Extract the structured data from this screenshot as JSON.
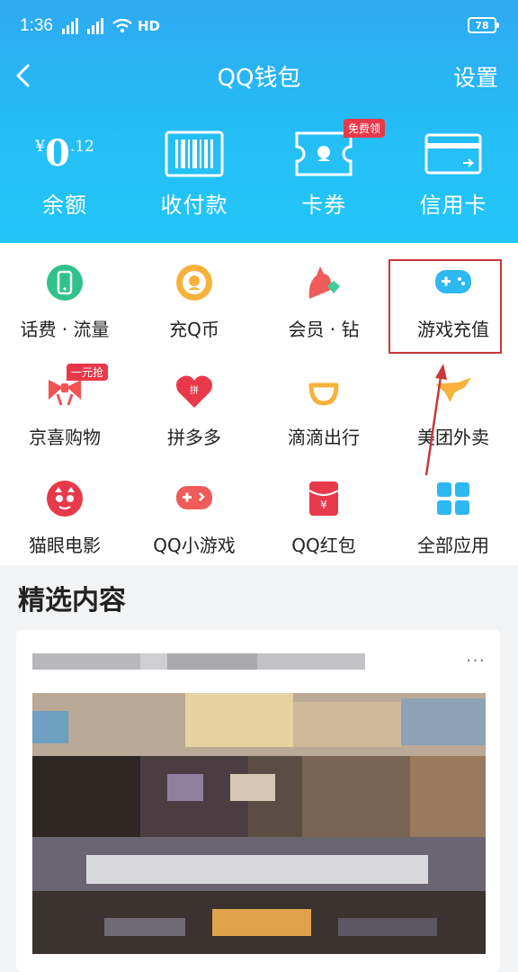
{
  "status": {
    "time": "1:36",
    "network_1": "4G",
    "network_2": "4G",
    "hd": "HD",
    "battery": "78"
  },
  "header": {
    "title": "QQ钱包",
    "settings": "设置"
  },
  "quick": {
    "balance": {
      "currency": "¥",
      "integer": "0",
      "decimal": ".12",
      "label": "余额"
    },
    "items": [
      {
        "label": "收付款",
        "icon": "barcode-icon"
      },
      {
        "label": "卡券",
        "icon": "ticket-icon",
        "tag": "免费领"
      },
      {
        "label": "信用卡",
        "icon": "credit-card-icon"
      }
    ]
  },
  "grid": [
    {
      "label": "话费 · 流量",
      "icon": "phone-icon",
      "color": "#2fc38a"
    },
    {
      "label": "充Q币",
      "icon": "qq-coin-icon",
      "color": "#f7b23c"
    },
    {
      "label": "会员 · 钻",
      "icon": "member-diamond-icon",
      "color": "#f05b5b"
    },
    {
      "label": "游戏充值",
      "icon": "gamepad-icon",
      "color": "#2db8f2"
    },
    {
      "label": "京喜购物",
      "icon": "jingxi-icon",
      "color": "#f25353",
      "tag": "一元抢"
    },
    {
      "label": "拼多多",
      "icon": "pinduoduo-icon",
      "color": "#e8394a"
    },
    {
      "label": "滴滴出行",
      "icon": "didi-icon",
      "color": "#f7b23c"
    },
    {
      "label": "美团外卖",
      "icon": "meituan-icon",
      "color": "#f7b23c"
    },
    {
      "label": "猫眼电影",
      "icon": "maoyan-icon",
      "color": "#e8394a"
    },
    {
      "label": "QQ小游戏",
      "icon": "mini-game-icon",
      "color": "#f05b5b"
    },
    {
      "label": "QQ红包",
      "icon": "red-packet-icon",
      "color": "#e8394a"
    },
    {
      "label": "全部应用",
      "icon": "all-apps-icon",
      "color": "#2db8f2"
    }
  ],
  "content": {
    "section_title": "精选内容",
    "more": "···"
  },
  "colors": {
    "header_top": "#2ea9f3",
    "header_bottom": "#22c6f7",
    "highlight": "#c8373a"
  }
}
